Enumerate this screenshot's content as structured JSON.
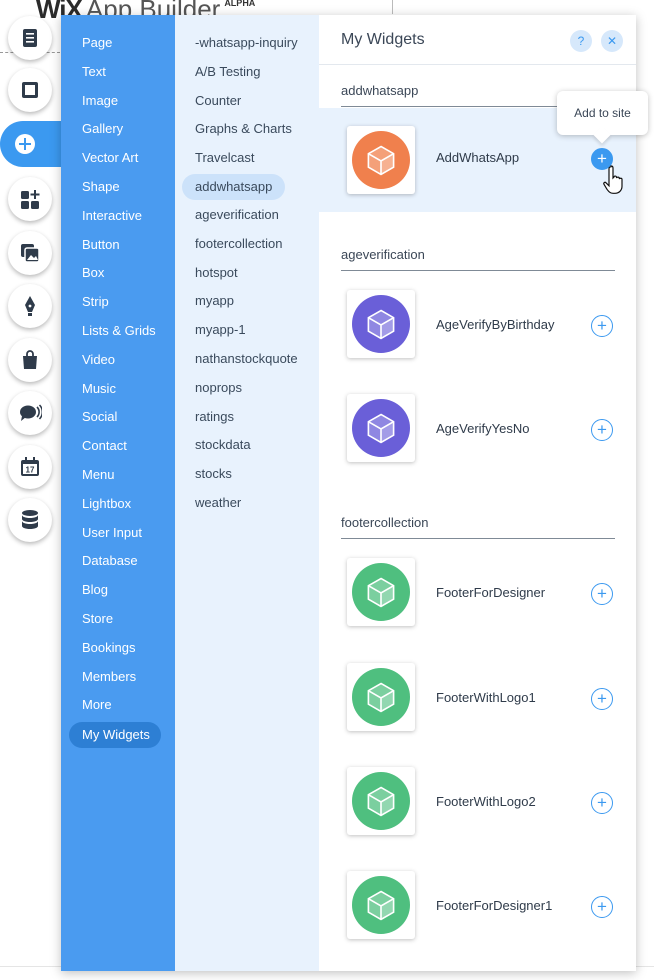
{
  "brand": {
    "logo": "WiX",
    "name": "App Builder",
    "badge": "ALPHA"
  },
  "tools": [
    {
      "name": "pages-icon"
    },
    {
      "name": "background-icon"
    },
    {
      "name": "add-icon",
      "active": true
    },
    {
      "name": "app-market-icon"
    },
    {
      "name": "media-icon"
    },
    {
      "name": "pen-icon"
    },
    {
      "name": "store-bag-icon"
    },
    {
      "name": "chat-icon"
    },
    {
      "name": "calendar-icon",
      "text": "17"
    },
    {
      "name": "database-icon"
    }
  ],
  "categories": [
    "Page",
    "Text",
    "Image",
    "Gallery",
    "Vector Art",
    "Shape",
    "Interactive",
    "Button",
    "Box",
    "Strip",
    "Lists & Grids",
    "Video",
    "Music",
    "Social",
    "Contact",
    "Menu",
    "Lightbox",
    "User Input",
    "Database",
    "Blog",
    "Store",
    "Bookings",
    "Members",
    "More",
    "My Widgets"
  ],
  "selected_category": "My Widgets",
  "subcategories": [
    "-whatsapp-inquiry",
    "A/B Testing",
    "Counter",
    "Graphs & Charts",
    "Travelcast",
    "addwhatsapp",
    "ageverification",
    "footercollection",
    "hotspot",
    "myapp",
    "myapp-1",
    "nathanstockquote",
    "noprops",
    "ratings",
    "stockdata",
    "stocks",
    "weather"
  ],
  "selected_subcategory": "addwhatsapp",
  "main": {
    "title": "My Widgets",
    "help_label": "?",
    "close_label": "✕",
    "add_label": "+",
    "tooltip": "Add to site",
    "sections": [
      {
        "title": "addwhatsapp",
        "widgets": [
          {
            "name": "AddWhatsApp",
            "color": "#f0804d"
          }
        ]
      },
      {
        "title": "ageverification",
        "widgets": [
          {
            "name": "AgeVerifyByBirthday",
            "color": "#6a5fd8"
          },
          {
            "name": "AgeVerifyYesNo",
            "color": "#6a5fd8"
          }
        ]
      },
      {
        "title": "footercollection",
        "widgets": [
          {
            "name": "FooterForDesigner",
            "color": "#4fbf7f"
          },
          {
            "name": "FooterWithLogo1",
            "color": "#4fbf7f"
          },
          {
            "name": "FooterWithLogo2",
            "color": "#4fbf7f"
          },
          {
            "name": "FooterForDesigner1",
            "color": "#4fbf7f"
          }
        ]
      }
    ]
  },
  "colors": {
    "accent": "#3b99f0",
    "category_bg": "#4a9bf0",
    "subcategory_bg": "#e8f2fd"
  }
}
